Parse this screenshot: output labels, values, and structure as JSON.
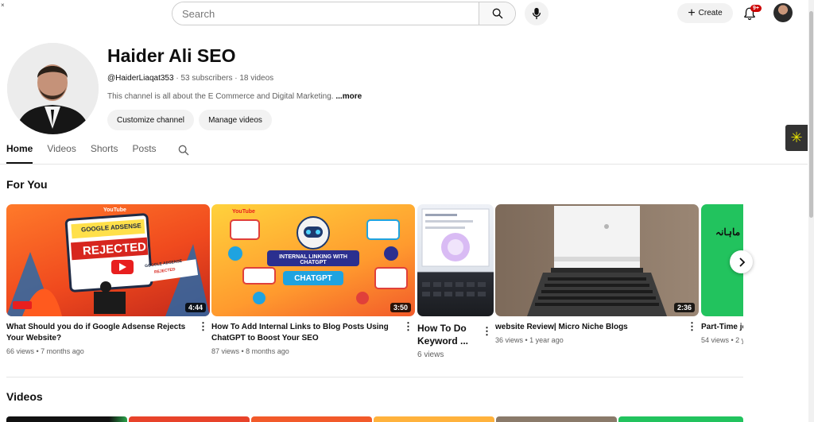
{
  "topbar": {
    "search_placeholder": "Search",
    "create_label": "Create",
    "notification_count": "9+"
  },
  "channel": {
    "name": "Haider Ali SEO",
    "handle": "@HaiderLiaqat353",
    "subscribers": "53 subscribers",
    "videos_count": "18 videos",
    "description": "This channel is all about the E Commerce and Digital Marketing.",
    "more_label": "...more",
    "customize_label": "Customize channel",
    "manage_label": "Manage videos"
  },
  "tabs": [
    {
      "label": "Home",
      "active": true
    },
    {
      "label": "Videos",
      "active": false
    },
    {
      "label": "Shorts",
      "active": false
    },
    {
      "label": "Posts",
      "active": false
    }
  ],
  "sections": {
    "for_you": "For You",
    "videos": "Videos"
  },
  "cards": [
    {
      "title": "What Should you do if Google Adsense Rejects Your Website?",
      "views": "66 views",
      "age": "7 months ago",
      "duration": "4:44",
      "thumb_text": {
        "brand": "YouTube",
        "line1": "GOOGLE ADSENSE",
        "line2": "REJECTED",
        "line3": "GOOGLE ADSENSE",
        "line4": "REJECTED"
      }
    },
    {
      "title": "How To Add Internal Links to Blog Posts Using ChatGPT to Boost Your SEO",
      "views": "87 views",
      "age": "8 months ago",
      "duration": "3:50",
      "thumb_text": {
        "brand": "YouTube",
        "line1": "INTERNAL LINKING WITH CHATGPT",
        "line2": "CHATGPT"
      }
    },
    {
      "title": "How To Do Keyword ...",
      "views": "6 views",
      "age": ""
    },
    {
      "title": "website Review| Micro Niche Blogs",
      "views": "36 views",
      "age": "1 year ago",
      "duration": "2:36"
    },
    {
      "title": "Part-Time jo",
      "views": "54 views",
      "age": "2 y",
      "thumb_text": {
        "line1": "ماہانہ"
      }
    }
  ],
  "colors": {
    "youtube_red": "#cc0000",
    "extension_accent": "#e8e300"
  }
}
